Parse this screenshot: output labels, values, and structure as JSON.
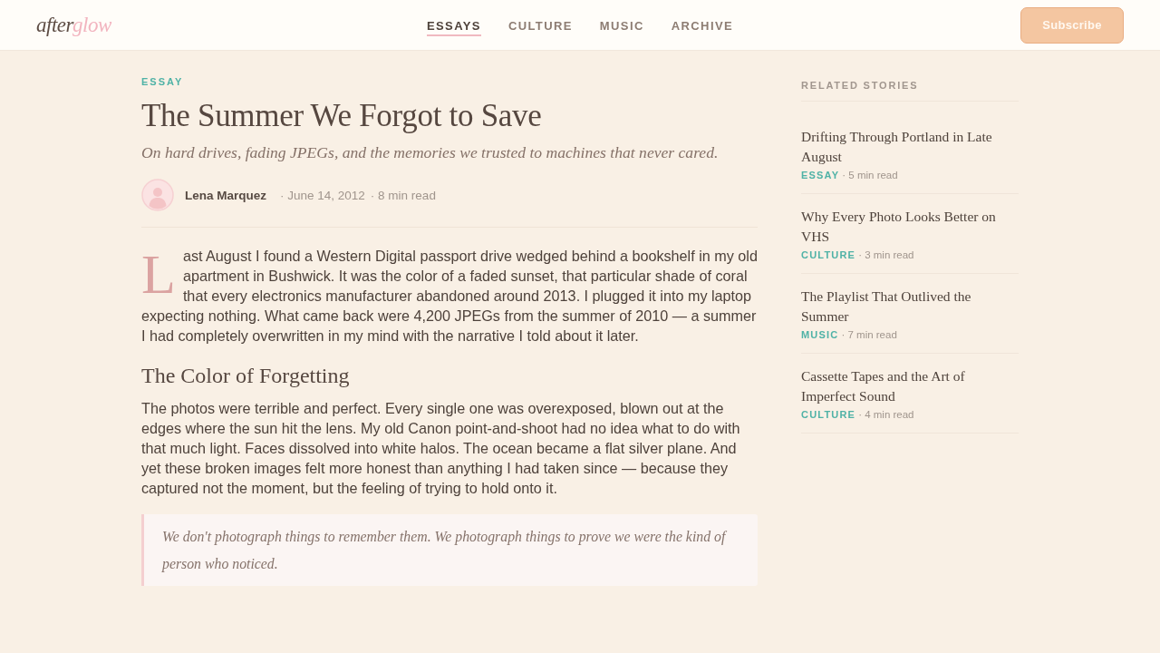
{
  "header": {
    "logo": [
      "after",
      "glow"
    ],
    "nav": [
      {
        "label": "ESSAYS",
        "selected": true
      },
      {
        "label": "CULTURE",
        "selected": false
      },
      {
        "label": "MUSIC",
        "selected": false
      },
      {
        "label": "ARCHIVE",
        "selected": false
      }
    ],
    "subscribe_button": "Subscribe"
  },
  "article": {
    "category": "ESSAY",
    "title": "The Summer We Forgot to Save",
    "subtitle": "On hard drives, fading JPEGs, and the memories we trusted to machines that never cared.",
    "author": {
      "name": "Lena Marquez"
    },
    "meta": [
      "· June 14, 2012",
      "· 8 min read"
    ],
    "body": [
      {
        "kind": "paragraph",
        "drop_cap": true,
        "text": "Last August I found a Western Digital passport drive wedged behind a bookshelf in my old apartment in Bushwick. It was the color of a faded sunset, that particular shade of coral that every electronics manufacturer abandoned around 2013. I plugged it into my laptop expecting nothing. What came back were 4,200 JPEGs from the summer of 2010 — a summer I had completely overwritten in my mind with the narrative I told about it later."
      },
      {
        "kind": "heading",
        "text": "The Color of Forgetting"
      },
      {
        "kind": "paragraph",
        "drop_cap": false,
        "text": "The photos were terrible and perfect. Every single one was overexposed, blown out at the edges where the sun hit the lens. My old Canon point-and-shoot had no idea what to do with that much light. Faces dissolved into white halos. The ocean became a flat silver plane. And yet these broken images felt more honest than anything I had taken since — because they captured not the moment, but the feeling of trying to hold onto it."
      },
      {
        "kind": "quote",
        "text": "We don't photograph things to remember them. We photograph things to prove we were the kind of person who noticed."
      }
    ]
  },
  "sidebar": {
    "title": "RELATED STORIES",
    "stories": [
      {
        "title": "Drifting Through Portland in Late August",
        "category": "ESSAY",
        "read_time": "· 5 min read"
      },
      {
        "title": "Why Every Photo Looks Better on VHS",
        "category": "CULTURE",
        "read_time": "· 3 min read"
      },
      {
        "title": "The Playlist That Outlived the Summer",
        "category": "MUSIC",
        "read_time": "· 7 min read"
      },
      {
        "title": "Cassette Tapes and the Art of Imperfect Sound",
        "category": "CULTURE",
        "read_time": "· 4 min read"
      }
    ]
  }
}
